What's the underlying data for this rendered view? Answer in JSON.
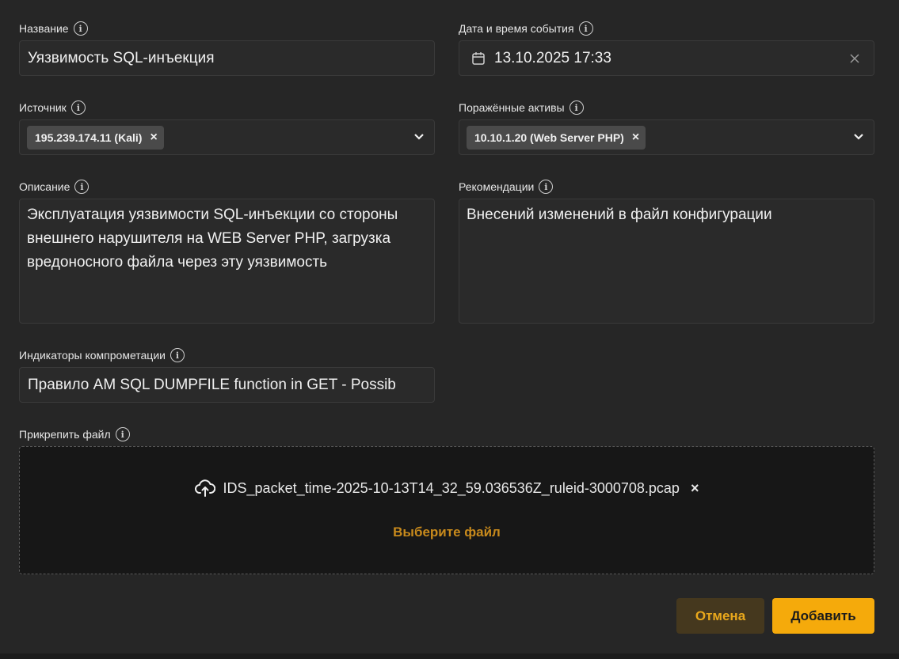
{
  "fields": {
    "name": {
      "label": "Название",
      "value": "Уязвимость SQL-инъекция"
    },
    "datetime": {
      "label": "Дата и время события",
      "value": "13.10.2025 17:33"
    },
    "source": {
      "label": "Источник",
      "chips": [
        "195.239.174.11 (Kali)"
      ]
    },
    "assets": {
      "label": "Поражённые активы",
      "chips": [
        "10.10.1.20 (Web Server PHP)"
      ]
    },
    "description": {
      "label": "Описание",
      "value": "Эксплуатация уязвимости SQL-инъекции со стороны внешнего нарушителя на WEB Server PHP, загрузка вредоносного файла через эту уязвимость"
    },
    "recommendations": {
      "label": "Рекомендации",
      "value": "Внесений изменений в файл конфигурации"
    },
    "ioc": {
      "label": "Индикаторы компрометации",
      "value": "Правило AM SQL DUMPFILE function in GET - Possib"
    },
    "attach": {
      "label": "Прикрепить файл",
      "file_name": "IDS_packet_time-2025-10-13T14_32_59.036536Z_ruleid-3000708.pcap",
      "choose_label": "Выберите файл"
    }
  },
  "buttons": {
    "cancel": "Отмена",
    "add": "Добавить"
  },
  "icons": {
    "info": "info-icon",
    "calendar": "calendar-icon",
    "clear": "close-icon",
    "chevron": "chevron-down-icon",
    "upload": "cloud-upload-icon",
    "remove": "close-icon"
  },
  "info_glyph": "i",
  "remove_glyph": "×",
  "colors": {
    "accent": "#f5aa0b",
    "accent_text": "#c88a1c",
    "background": "#262626"
  }
}
